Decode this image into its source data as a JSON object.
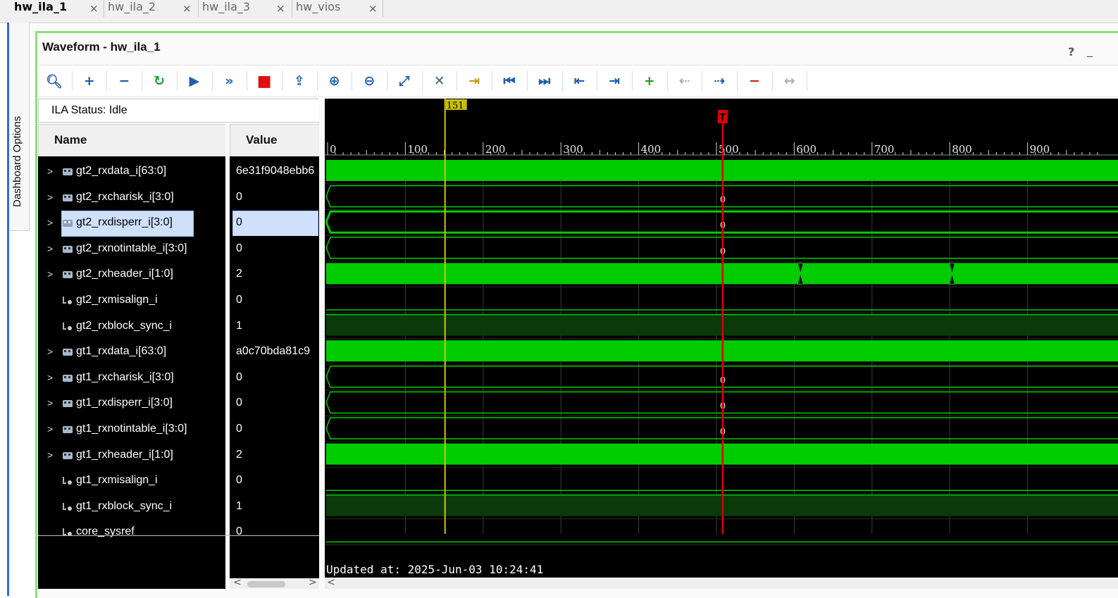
{
  "tabs": [
    {
      "label": "hw_ila_1",
      "active": true
    },
    {
      "label": "hw_ila_2",
      "active": false
    },
    {
      "label": "hw_ila_3",
      "active": false
    },
    {
      "label": "hw_vios",
      "active": false
    }
  ],
  "close_glyph": "×",
  "dashboard_label": "Dashboard Options",
  "panel": {
    "title": "Waveform - hw_ila_1",
    "help": "?",
    "minimize": "_"
  },
  "toolbar": [
    {
      "name": "search-icon",
      "glyph": "🔍︎"
    },
    {
      "name": "add-icon",
      "glyph": "+"
    },
    {
      "name": "remove-icon",
      "glyph": "−"
    },
    {
      "name": "run-trigger-immediate-icon",
      "glyph": "↻"
    },
    {
      "name": "run-trigger-icon",
      "glyph": "▶"
    },
    {
      "name": "auto-retrigger-icon",
      "glyph": "»"
    },
    {
      "name": "stop-icon",
      "glyph": "■"
    },
    {
      "name": "export-icon",
      "glyph": "⇪"
    },
    {
      "name": "zoom-in-icon",
      "glyph": "⊕"
    },
    {
      "name": "zoom-out-icon",
      "glyph": "⊖"
    },
    {
      "name": "zoom-fit-icon",
      "glyph": "⤢"
    },
    {
      "name": "cursor-icon",
      "glyph": "✕"
    },
    {
      "name": "go-to-cursor-icon",
      "glyph": "⇥"
    },
    {
      "name": "go-to-time-zero-icon",
      "glyph": "⏮"
    },
    {
      "name": "go-to-last-time-icon",
      "glyph": "⏭"
    },
    {
      "name": "previous-transition-icon",
      "glyph": "⇤"
    },
    {
      "name": "next-transition-icon",
      "glyph": "⇥"
    },
    {
      "name": "add-marker-icon",
      "glyph": "+"
    },
    {
      "name": "previous-marker-icon",
      "glyph": "⇠"
    },
    {
      "name": "next-marker-icon",
      "glyph": "⇢"
    },
    {
      "name": "delete-marker-icon",
      "glyph": "−"
    },
    {
      "name": "swap-cursors-icon",
      "glyph": "↔"
    }
  ],
  "ila_status": "ILA Status:  Idle",
  "columns": {
    "name": "Name",
    "value": "Value"
  },
  "signals": [
    {
      "name": "gt2_rxdata_i[63:0]",
      "value": "6e31f9048ebb6",
      "bus": true,
      "kind": "bus-data"
    },
    {
      "name": "gt2_rxcharisk_i[3:0]",
      "value": "0",
      "bus": true,
      "kind": "bus-zero"
    },
    {
      "name": "gt2_rxdisperr_i[3:0]",
      "value": "0",
      "bus": true,
      "kind": "bus-zero",
      "selected": true
    },
    {
      "name": "gt2_rxnotintable_i[3:0]",
      "value": "0",
      "bus": true,
      "kind": "bus-zero"
    },
    {
      "name": "gt2_rxheader_i[1:0]",
      "value": "2",
      "bus": true,
      "kind": "bus-header"
    },
    {
      "name": "gt2_rxmisalign_i",
      "value": "0",
      "bus": false,
      "kind": "bit-low"
    },
    {
      "name": "gt2_rxblock_sync_i",
      "value": "1",
      "bus": false,
      "kind": "bit-high"
    },
    {
      "name": "gt1_rxdata_i[63:0]",
      "value": "a0c70bda81c9",
      "bus": true,
      "kind": "bus-data"
    },
    {
      "name": "gt1_rxcharisk_i[3:0]",
      "value": "0",
      "bus": true,
      "kind": "bus-zero"
    },
    {
      "name": "gt1_rxdisperr_i[3:0]",
      "value": "0",
      "bus": true,
      "kind": "bus-zero"
    },
    {
      "name": "gt1_rxnotintable_i[3:0]",
      "value": "0",
      "bus": true,
      "kind": "bus-zero"
    },
    {
      "name": "gt1_rxheader_i[1:0]",
      "value": "2",
      "bus": true,
      "kind": "bus-data"
    },
    {
      "name": "gt1_rxmisalign_i",
      "value": "0",
      "bus": false,
      "kind": "bit-low"
    },
    {
      "name": "gt1_rxblock_sync_i",
      "value": "1",
      "bus": false,
      "kind": "bit-high"
    },
    {
      "name": "core_sysref",
      "value": "0",
      "bus": false,
      "kind": "bit-low"
    }
  ],
  "timeline": {
    "ticks": [
      "0",
      "100",
      "200",
      "300",
      "400",
      "500",
      "600",
      "700",
      "800",
      "900"
    ],
    "range": [
      0,
      990
    ],
    "cursor_label": "151",
    "cursor_time": 151,
    "trigger_time": 508,
    "trigger_label": "T",
    "header_transitions": [
      608,
      803
    ],
    "bus_zero_value": "0",
    "colors": {
      "bus": "#00cc00",
      "line": "#00cc00",
      "high_fill": "#0a3a0a",
      "cursor": "#d4c400",
      "trigger": "#dd0000",
      "grid": "#3a3a3a"
    }
  },
  "updated_text": "Updated at: 2025-Jun-03 10:24:41",
  "scroll": {
    "left": "<",
    "right": ">"
  }
}
